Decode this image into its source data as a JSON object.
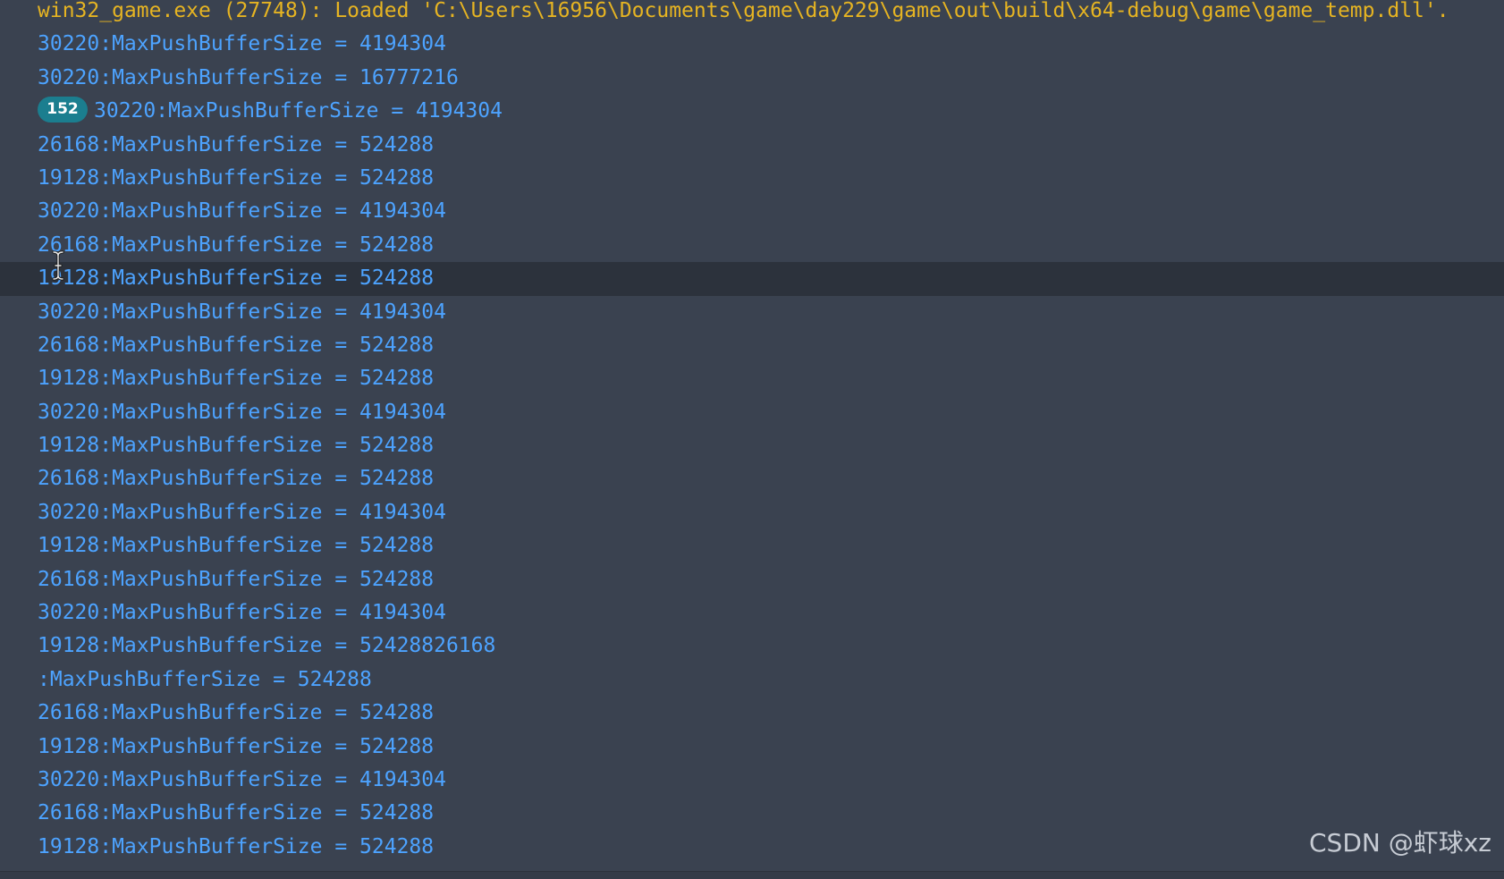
{
  "output": {
    "lines": [
      {
        "text": "win32_game.exe (27748): Loaded 'C:\\Users\\16956\\Documents\\game\\day229\\game\\out\\build\\x64-debug\\game\\game_temp.dll'.",
        "kind": "header"
      },
      {
        "text": "30220:MaxPushBufferSize = 4194304"
      },
      {
        "text": "30220:MaxPushBufferSize = 16777216"
      },
      {
        "text": "30220:MaxPushBufferSize = 4194304",
        "badge": "152"
      },
      {
        "text": "26168:MaxPushBufferSize = 524288"
      },
      {
        "text": "19128:MaxPushBufferSize = 524288"
      },
      {
        "text": "30220:MaxPushBufferSize = 4194304"
      },
      {
        "text": "26168:MaxPushBufferSize = 524288"
      },
      {
        "text": "19128:MaxPushBufferSize = 524288",
        "highlighted": true
      },
      {
        "text": "30220:MaxPushBufferSize = 4194304"
      },
      {
        "text": "26168:MaxPushBufferSize = 524288"
      },
      {
        "text": "19128:MaxPushBufferSize = 524288"
      },
      {
        "text": "30220:MaxPushBufferSize = 4194304"
      },
      {
        "text": "19128:MaxPushBufferSize = 524288"
      },
      {
        "text": "26168:MaxPushBufferSize = 524288"
      },
      {
        "text": "30220:MaxPushBufferSize = 4194304"
      },
      {
        "text": "19128:MaxPushBufferSize = 524288"
      },
      {
        "text": "26168:MaxPushBufferSize = 524288"
      },
      {
        "text": "30220:MaxPushBufferSize = 4194304"
      },
      {
        "text": "19128:MaxPushBufferSize = 52428826168"
      },
      {
        "text": ":MaxPushBufferSize = 524288"
      },
      {
        "text": "26168:MaxPushBufferSize = 524288"
      },
      {
        "text": "19128:MaxPushBufferSize = 524288"
      },
      {
        "text": "30220:MaxPushBufferSize = 4194304"
      },
      {
        "text": "26168:MaxPushBufferSize = 524288"
      },
      {
        "text": "19128:MaxPushBufferSize = 524288"
      }
    ]
  },
  "watermark": "CSDN @虾球xz",
  "icons": {
    "cursor": "text-cursor-icon"
  },
  "colors": {
    "background": "#3a4250",
    "log_text": "#4da3ff",
    "header_text": "#e6b422",
    "highlight_row": "#2c323c",
    "badge": "#1b7e8f"
  }
}
